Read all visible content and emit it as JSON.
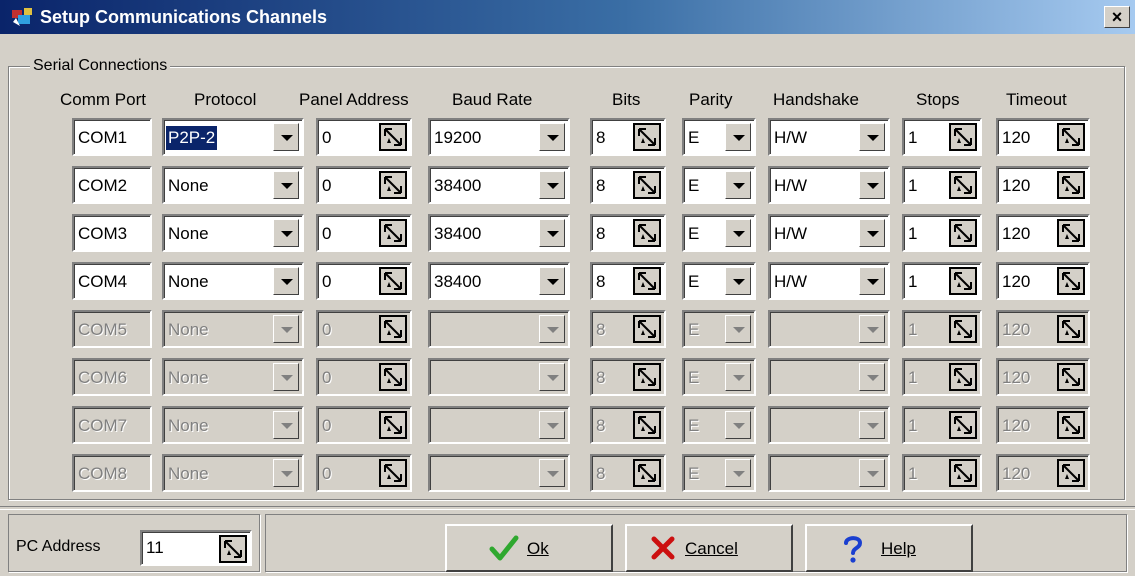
{
  "window": {
    "title": "Setup Communications Channels",
    "close_label": "×"
  },
  "group_label": "Serial Connections",
  "headers": {
    "comm_port": "Comm Port",
    "protocol": "Protocol",
    "panel_address": "Panel Address",
    "baud_rate": "Baud Rate",
    "bits": "Bits",
    "parity": "Parity",
    "handshake": "Handshake",
    "stops": "Stops",
    "timeout": "Timeout"
  },
  "rows": [
    {
      "port": "COM1",
      "protocol": "P2P-2",
      "address": "0",
      "baud": "19200",
      "bits": "8",
      "parity": "E",
      "handshake": "H/W",
      "stops": "1",
      "timeout": "120",
      "enabled": true
    },
    {
      "port": "COM2",
      "protocol": "None",
      "address": "0",
      "baud": "38400",
      "bits": "8",
      "parity": "E",
      "handshake": "H/W",
      "stops": "1",
      "timeout": "120",
      "enabled": true
    },
    {
      "port": "COM3",
      "protocol": "None",
      "address": "0",
      "baud": "38400",
      "bits": "8",
      "parity": "E",
      "handshake": "H/W",
      "stops": "1",
      "timeout": "120",
      "enabled": true
    },
    {
      "port": "COM4",
      "protocol": "None",
      "address": "0",
      "baud": "38400",
      "bits": "8",
      "parity": "E",
      "handshake": "H/W",
      "stops": "1",
      "timeout": "120",
      "enabled": true
    },
    {
      "port": "COM5",
      "protocol": "None",
      "address": "0",
      "baud": "",
      "bits": "8",
      "parity": "E",
      "handshake": "",
      "stops": "1",
      "timeout": "120",
      "enabled": false
    },
    {
      "port": "COM6",
      "protocol": "None",
      "address": "0",
      "baud": "",
      "bits": "8",
      "parity": "E",
      "handshake": "",
      "stops": "1",
      "timeout": "120",
      "enabled": false
    },
    {
      "port": "COM7",
      "protocol": "None",
      "address": "0",
      "baud": "",
      "bits": "8",
      "parity": "E",
      "handshake": "",
      "stops": "1",
      "timeout": "120",
      "enabled": false
    },
    {
      "port": "COM8",
      "protocol": "None",
      "address": "0",
      "baud": "",
      "bits": "8",
      "parity": "E",
      "handshake": "",
      "stops": "1",
      "timeout": "120",
      "enabled": false
    }
  ],
  "footer": {
    "pc_address_label": "PC Address",
    "pc_address_value": "11",
    "ok_label": "Ok",
    "cancel_label": "Cancel",
    "help_label": "Help"
  },
  "colors": {
    "titlebar_start": "#0a246a",
    "titlebar_end": "#a6caf0",
    "ok_check": "#2fa82f",
    "cancel_x": "#cc1010",
    "help_q": "#1a3fd0"
  }
}
